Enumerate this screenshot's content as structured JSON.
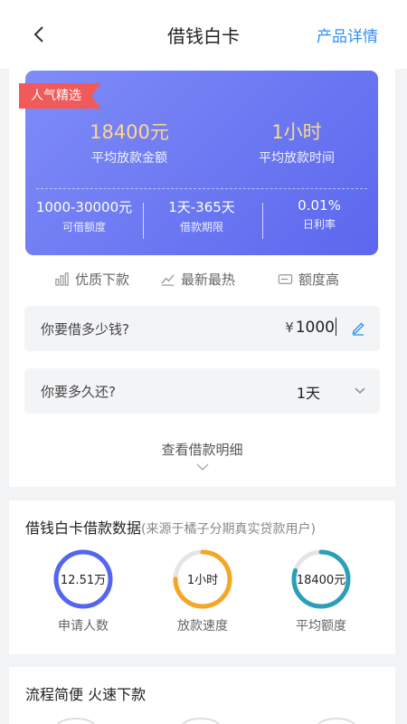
{
  "header": {
    "title": "借钱白卡",
    "detail_link": "产品详情",
    "back_icon": "chevron-left-icon"
  },
  "card": {
    "tag": "人气精选",
    "avg_amount": {
      "value": "18400元",
      "label": "平均放款金额"
    },
    "avg_time": {
      "value": "1小时",
      "label": "平均放款时间"
    },
    "limits": [
      {
        "value": "1000-30000元",
        "label": "可借额度"
      },
      {
        "value": "1天-365天",
        "label": "借款期限"
      },
      {
        "value": "0.01%",
        "label": "日利率"
      }
    ]
  },
  "features": [
    {
      "label": "优质下款",
      "icon": "chart-icon"
    },
    {
      "label": "最新最热",
      "icon": "trend-icon"
    },
    {
      "label": "额度高",
      "icon": "card-icon"
    }
  ],
  "amount_field": {
    "question": "你要借多少钱?",
    "currency": "¥",
    "value": "1000",
    "icon": "pencil-icon"
  },
  "term_field": {
    "question": "你要多久还?",
    "value": "1天",
    "icon": "chevron-down-icon"
  },
  "view_details": "查看借款明细",
  "stats": {
    "title": "借钱白卡借款数据",
    "subtitle": "(来源于橘子分期真实贷款用户)",
    "gauges": [
      {
        "value": "12.51万",
        "label": "申请人数",
        "color": "#5466f0",
        "fill": 1.0
      },
      {
        "value": "1小时",
        "label": "放款速度",
        "color": "#f5a623",
        "fill": 0.75
      },
      {
        "value": "18400元",
        "label": "平均额度",
        "color": "#2b9fb8",
        "fill": 0.8
      }
    ]
  },
  "flow": {
    "title": "流程简便 火速下款"
  },
  "colors": {
    "accent": "#2f8ff0",
    "card": "#6b78f2",
    "tag": "#f25a5a",
    "highlight": "#ffd888"
  }
}
